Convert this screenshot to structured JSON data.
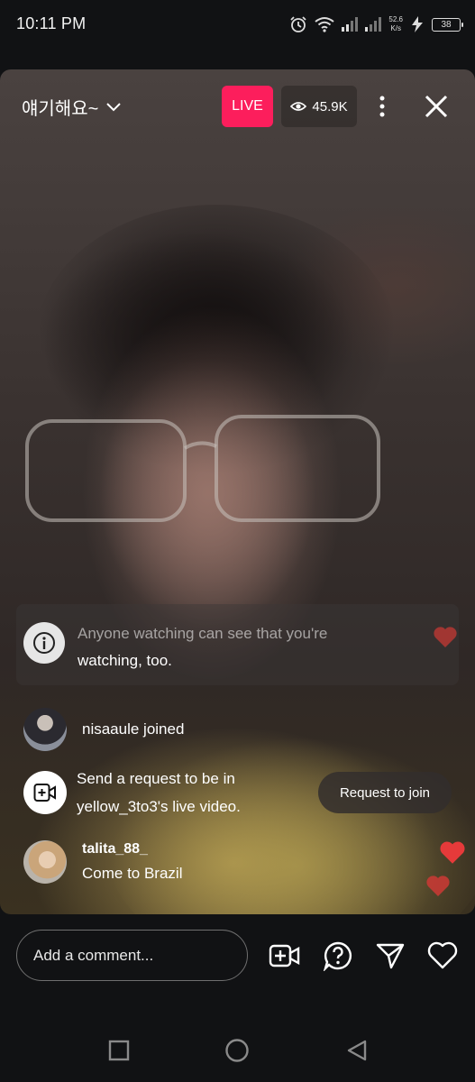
{
  "status_bar": {
    "time": "10:11 PM",
    "net_speed_value": "52.6",
    "net_speed_unit": "K/s",
    "battery": "38",
    "icons": [
      "alarm-icon",
      "wifi-icon",
      "signal-icon",
      "signal-icon-2",
      "charging-icon",
      "battery-icon"
    ]
  },
  "live": {
    "title": "얘기해요~",
    "badge": "LIVE",
    "viewers": "45.9K",
    "accent": "#fc1e5c"
  },
  "notice": {
    "line1": "Anyone watching can see that you're",
    "line2": "watching, too."
  },
  "feed": {
    "joined": "nisaaule joined",
    "request_line1": "Send a request to be in",
    "request_line2": "yellow_3to3's live video.",
    "request_button": "Request to join",
    "comment_user": "talita_88_",
    "comment_text": "Come to Brazil"
  },
  "composer": {
    "placeholder": "Add a comment..."
  },
  "colors": {
    "heart": "#e63a3a",
    "background": "#111214"
  }
}
